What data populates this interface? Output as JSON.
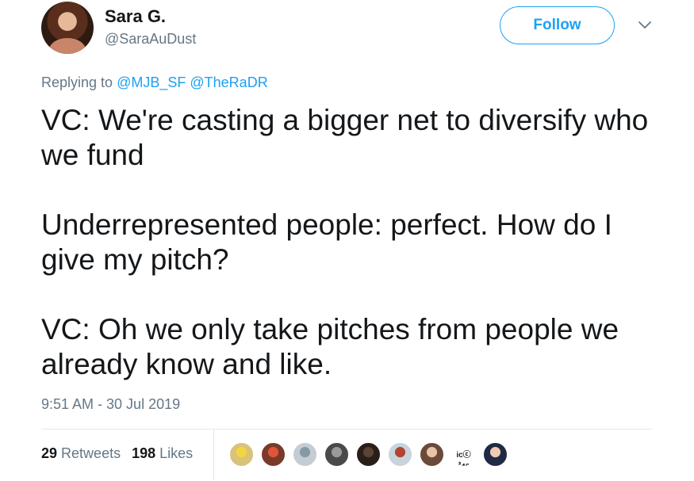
{
  "author": {
    "name": "Sara G.",
    "handle": "@SaraAuDust",
    "avatar_icon": "profile-photo"
  },
  "follow_label": "Follow",
  "replying": {
    "prefix": "Replying to",
    "mentions": [
      "@MJB_SF",
      "@TheRaDR"
    ]
  },
  "tweet": {
    "paragraphs": [
      "VC: We're casting a bigger net to diversify who we fund",
      "Underrepresented people: perfect. How do I give my pitch?",
      "VC: Oh we only take pitches from people we already know and like."
    ]
  },
  "timestamp": "9:51 AM - 30 Jul 2019",
  "stats": {
    "retweets_count": "29",
    "retweets_label": "Retweets",
    "likes_count": "198",
    "likes_label": "Likes"
  },
  "likers": [
    {
      "name": "liker-avatar-1",
      "color": "#d9c27a",
      "accent": "#f2d640",
      "label": ""
    },
    {
      "name": "liker-avatar-2",
      "color": "#7a3a2a",
      "accent": "#e0553a",
      "label": ""
    },
    {
      "name": "liker-avatar-3",
      "color": "#c4ccd4",
      "accent": "#8899a6",
      "label": ""
    },
    {
      "name": "liker-avatar-4",
      "color": "#4a4a4a",
      "accent": "#9a9a9a",
      "label": ""
    },
    {
      "name": "liker-avatar-5",
      "color": "#2a1e18",
      "accent": "#5a4236",
      "label": ""
    },
    {
      "name": "liker-avatar-6",
      "color": "#c9d3dc",
      "accent": "#b0442f",
      "label": ""
    },
    {
      "name": "liker-avatar-7",
      "color": "#6b4a3a",
      "accent": "#e8c3a8",
      "label": ""
    },
    {
      "name": "liker-avatar-8",
      "color": "#ffffff",
      "accent": "#19c37d",
      "label": "icⓒ ㎡401"
    },
    {
      "name": "liker-avatar-9",
      "color": "#1f2a44",
      "accent": "#f0c9b0",
      "label": ""
    }
  ]
}
